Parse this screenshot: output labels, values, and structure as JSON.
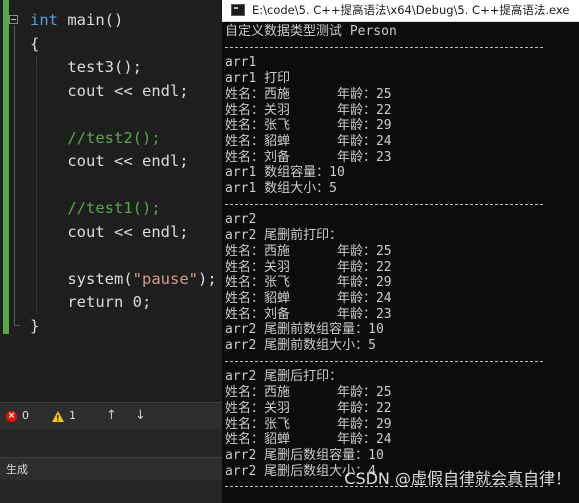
{
  "editor": {
    "lines": [
      [
        {
          "t": "int",
          "c": "tok-keyword"
        },
        {
          "t": " main()",
          "c": "tok-plain"
        }
      ],
      [
        {
          "t": "{",
          "c": "tok-plain"
        }
      ],
      [
        {
          "t": "    test3();",
          "c": "tok-plain"
        }
      ],
      [
        {
          "t": "    cout << endl;",
          "c": "tok-plain"
        }
      ],
      [],
      [
        {
          "t": "    //test2();",
          "c": "tok-comment"
        }
      ],
      [
        {
          "t": "    cout << endl;",
          "c": "tok-plain"
        }
      ],
      [],
      [
        {
          "t": "    //test1();",
          "c": "tok-comment"
        }
      ],
      [
        {
          "t": "    cout << endl;",
          "c": "tok-plain"
        }
      ],
      [],
      [
        {
          "t": "    system(",
          "c": "tok-plain"
        },
        {
          "t": "\"pause\"",
          "c": "tok-string"
        },
        {
          "t": ");",
          "c": "tok-plain"
        }
      ],
      [
        {
          "t": "    return 0;",
          "c": "tok-plain"
        }
      ],
      [
        {
          "t": "}",
          "c": "tok-plain"
        }
      ]
    ]
  },
  "status_bar": {
    "errors": "0",
    "warnings": "1",
    "up_arrow": "↑",
    "down_arrow": "↓"
  },
  "output_panel": {
    "label": "生成"
  },
  "console": {
    "title": "E:\\code\\5. C++提高语法\\x64\\Debug\\5. C++提高语法.exe",
    "lines": [
      "自定义数据类型测试 Person",
      "---",
      "arr1",
      "arr1 打印",
      "姓名：西施      年龄：25",
      "姓名：关羽      年龄：22",
      "姓名：张飞      年龄：29",
      "姓名：貂蝉      年龄：24",
      "姓名：刘备      年龄：23",
      "arr1 数组容量：10",
      "arr1 数组大小：5",
      "---",
      "arr2",
      "arr2 尾删前打印：",
      "姓名：西施      年龄：25",
      "姓名：关羽      年龄：22",
      "姓名：张飞      年龄：29",
      "姓名：貂蝉      年龄：24",
      "姓名：刘备      年龄：23",
      "arr2 尾删前数组容量：10",
      "arr2 尾删前数组大小：5",
      "---",
      "arr2 尾删后打印：",
      "姓名：西施      年龄：25",
      "姓名：关羽      年龄：22",
      "姓名：张飞      年龄：29",
      "姓名：貂蝉      年龄：24",
      "arr2 尾删后数组容量：10",
      "arr2 尾删后数组大小：4",
      "---"
    ],
    "watermark": "CSDN @虚假自律就会真自律！"
  }
}
